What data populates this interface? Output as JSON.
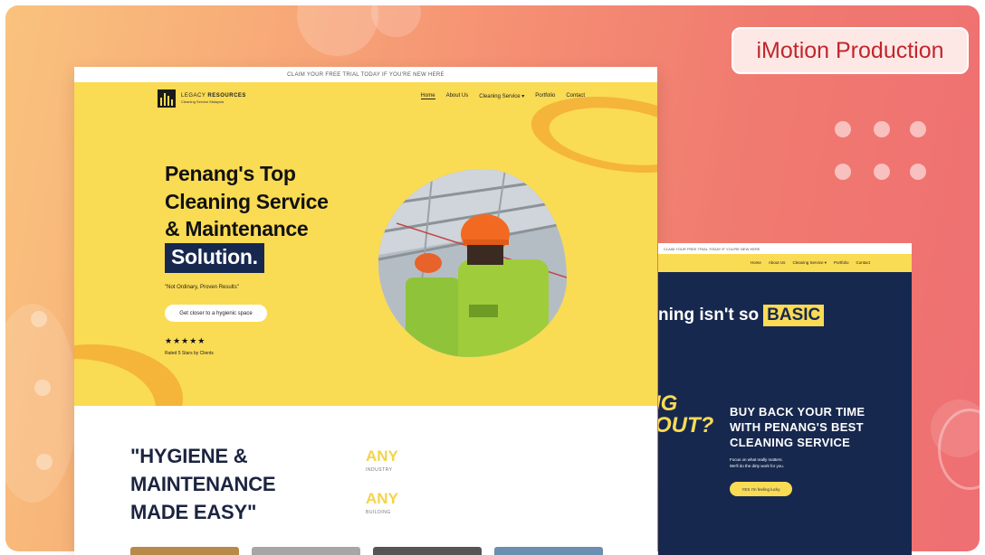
{
  "brand": {
    "label": "iMotion Production"
  },
  "main_site": {
    "topbar": "CLAIM YOUR FREE TRIAL TODAY IF YOU'RE NEW HERE",
    "logo": {
      "name_light": "LEGACY",
      "name_bold": "RESOURCES",
      "sub": "Cleaning Service Malaysia"
    },
    "nav": [
      "Home",
      "About Us",
      "Cleaning Service ▾",
      "Portfolio",
      "Contact"
    ],
    "hero": {
      "title_lines": [
        "Penang's Top",
        "Cleaning Service",
        "& Maintenance"
      ],
      "title_highlight": "Solution.",
      "tagline": "\"Not Ordinary, Proven Results\"",
      "cta": "Get closer to a hygienic space",
      "stars": "★★★★★",
      "rating": "Rated 5 Stars by Clients"
    },
    "lower": {
      "title_lines": [
        "\"HYGIENE &",
        "MAINTENANCE",
        "MADE EASY\""
      ],
      "any_items": [
        {
          "word": "ANY",
          "sub": "INDUSTRY"
        },
        {
          "word": "ANY",
          "sub": "BUILDING"
        }
      ]
    }
  },
  "second_site": {
    "topbar": "CLAIM YOUR FREE TRIAL TODAY IF YOU'RE NEW HERE",
    "nav": [
      "Home",
      "About Us",
      "Cleaning Service ▾",
      "Portfolio",
      "Contact"
    ],
    "headline": "ning isn't so",
    "headline_highlight": "BASIC",
    "side_big_lines": [
      "IG",
      "OUT?"
    ],
    "buyback_lines": [
      "BUY BACK YOUR TIME",
      "WITH PENANG'S BEST",
      "CLEANING SERVICE"
    ],
    "sub_lines": [
      "Focus on what really matters.",
      "We'll do the dirty work for you."
    ],
    "cta": "YES I'm feeling lucky"
  },
  "colors": {
    "brand_red": "#c0262d",
    "site_yellow": "#fadb54",
    "site_navy": "#17284f"
  },
  "icons": [
    "star-icon",
    "chevron-down-icon",
    "logo-building-icon"
  ]
}
